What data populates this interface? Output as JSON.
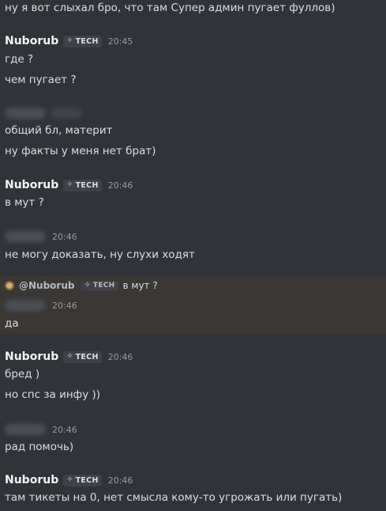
{
  "messages": {
    "top_line": "ну я вот слыхал бро, что там Супер админ пугает фуллов)",
    "g1": {
      "user": "Nuborub",
      "tag": "TECH",
      "time": "20:45",
      "lines": [
        "где ?",
        "чем пугает ?"
      ]
    },
    "g2": {
      "lines": [
        "общий бл, материт",
        "ну факты у меня нет брат)"
      ]
    },
    "g3": {
      "user": "Nuborub",
      "tag": "TECH",
      "time": "20:46",
      "lines": [
        "в мут ?"
      ]
    },
    "g4": {
      "time": "20:46",
      "lines": [
        "не могу доказать, ну слухи ходят"
      ]
    },
    "g5": {
      "reply": {
        "mention": "@Nuborub",
        "tag": "TECH",
        "text": "в мут ?"
      },
      "time": "20:46",
      "lines": [
        "да"
      ]
    },
    "g6": {
      "user": "Nuborub",
      "tag": "TECH",
      "time": "20:46",
      "lines": [
        "бред )",
        "но спс за инфу ))"
      ]
    },
    "g7": {
      "time": "20:46",
      "lines": [
        "рад помочь)"
      ]
    },
    "g8": {
      "user": "Nuborub",
      "tag": "TECH",
      "time": "20:46",
      "lines": [
        "там тикеты на 0, нет смысла кому-то угрожать или пугать)"
      ]
    }
  },
  "icons": {
    "tag_icon": "server-tag-icon",
    "reply_avatar": "reply-avatar-icon"
  },
  "colors": {
    "background": "#313338",
    "highlight": "#3a3734",
    "username": "#f2f3f5",
    "timestamp": "#949ba4"
  }
}
